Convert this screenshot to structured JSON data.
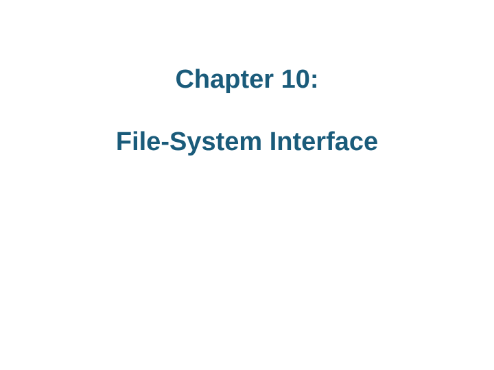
{
  "slide": {
    "chapter_label": "Chapter 10:",
    "chapter_title": "File-System Interface"
  }
}
